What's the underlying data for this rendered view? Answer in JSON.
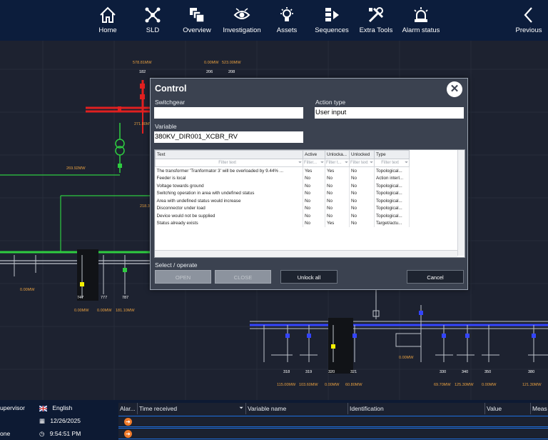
{
  "nav": {
    "items": [
      {
        "label": "Home",
        "icon": "home-icon"
      },
      {
        "label": "SLD",
        "icon": "sld-icon"
      },
      {
        "label": "Overview",
        "icon": "overview-icon"
      },
      {
        "label": "Investigation",
        "icon": "investigation-icon"
      },
      {
        "label": "Assets",
        "icon": "assets-icon"
      },
      {
        "label": "Sequences",
        "icon": "sequences-icon"
      },
      {
        "label": "Extra Tools",
        "icon": "extra-tools-icon"
      },
      {
        "label": "Alarm status",
        "icon": "alarm-status-icon"
      }
    ],
    "previous": "Previous"
  },
  "diagram": {
    "labels": {
      "p1": "578.81MW",
      "p1_id": "182",
      "p2": "0.00MW",
      "p2_id": "206",
      "p3": "523.00MW",
      "p3_id": "208",
      "p4": "271.80MW",
      "p5": "269.92MW",
      "p6": "218.3",
      "p7": "0.00MW",
      "f747": "747",
      "f777": "777",
      "f787": "787",
      "p8": "0.00MW",
      "p9": "0.00MW",
      "p10": "181.10MW",
      "f318": "318",
      "f319": "319",
      "f320": "320",
      "f321": "321",
      "p11": "115.00MW",
      "p12": "103.60MW",
      "p13": "0.00MW",
      "p14": "60.80MW",
      "p15": "0.00MW",
      "f330": "330",
      "f340": "340",
      "f350": "350",
      "f380": "380",
      "p16": "69.70MW",
      "p17": "125.30MW",
      "p18": "0.00MW",
      "p19": "121.30MW"
    }
  },
  "dialog": {
    "title": "Control",
    "switchgear_label": "Switchgear",
    "switchgear_value": "",
    "action_type_label": "Action type",
    "action_type_value": "User input",
    "variable_label": "Variable",
    "variable_value": "380KV_DIR001_XCBR_RV",
    "grid": {
      "columns": [
        "Text",
        "Active",
        "Unlocka...",
        "Unlocked",
        "Type"
      ],
      "filters": [
        "Filter text",
        "Filter...",
        "Filter t...",
        "Filter text",
        "Filter text"
      ],
      "rows": [
        [
          "The transformer 'Tranformator 3' will be overloaded by 9.44% ...",
          "Yes",
          "Yes",
          "No",
          "Topological..."
        ],
        [
          "Feeder is local",
          "No",
          "No",
          "No",
          "Action interl..."
        ],
        [
          "Voltage towards ground",
          "No",
          "No",
          "No",
          "Topological..."
        ],
        [
          "Switching operation in area with undefined status",
          "No",
          "No",
          "No",
          "Topological..."
        ],
        [
          "Area with undefined status would increase",
          "No",
          "No",
          "No",
          "Topological..."
        ],
        [
          "Disconnector under load",
          "No",
          "No",
          "No",
          "Topological..."
        ],
        [
          "Device would not be supplied",
          "No",
          "No",
          "No",
          "Topological..."
        ],
        [
          "Status already exists",
          "No",
          "Yes",
          "No",
          "Target/actu..."
        ]
      ]
    },
    "select_label": "Select / operate",
    "open_label": "OPEN",
    "close_label": "CLOSE",
    "unlock_all_label": "Unlock all",
    "cancel_label": "Cancel"
  },
  "status": {
    "role": "upervisor",
    "language": "English",
    "date": "12/26/2025",
    "time": "9:54:51 PM",
    "zone": "one"
  },
  "alarms": {
    "columns": [
      "Alar...",
      "Time received",
      "Variable name",
      "Identification",
      "Value",
      "Meas"
    ]
  },
  "colors": {
    "nav_bg": "#0c1d3c",
    "dialog_bg": "#3b4250",
    "busbar_green": "#2ecc40",
    "busbar_blue": "#3344ff",
    "busbar_red": "#e02020",
    "accent_orange": "#f07a2a"
  }
}
